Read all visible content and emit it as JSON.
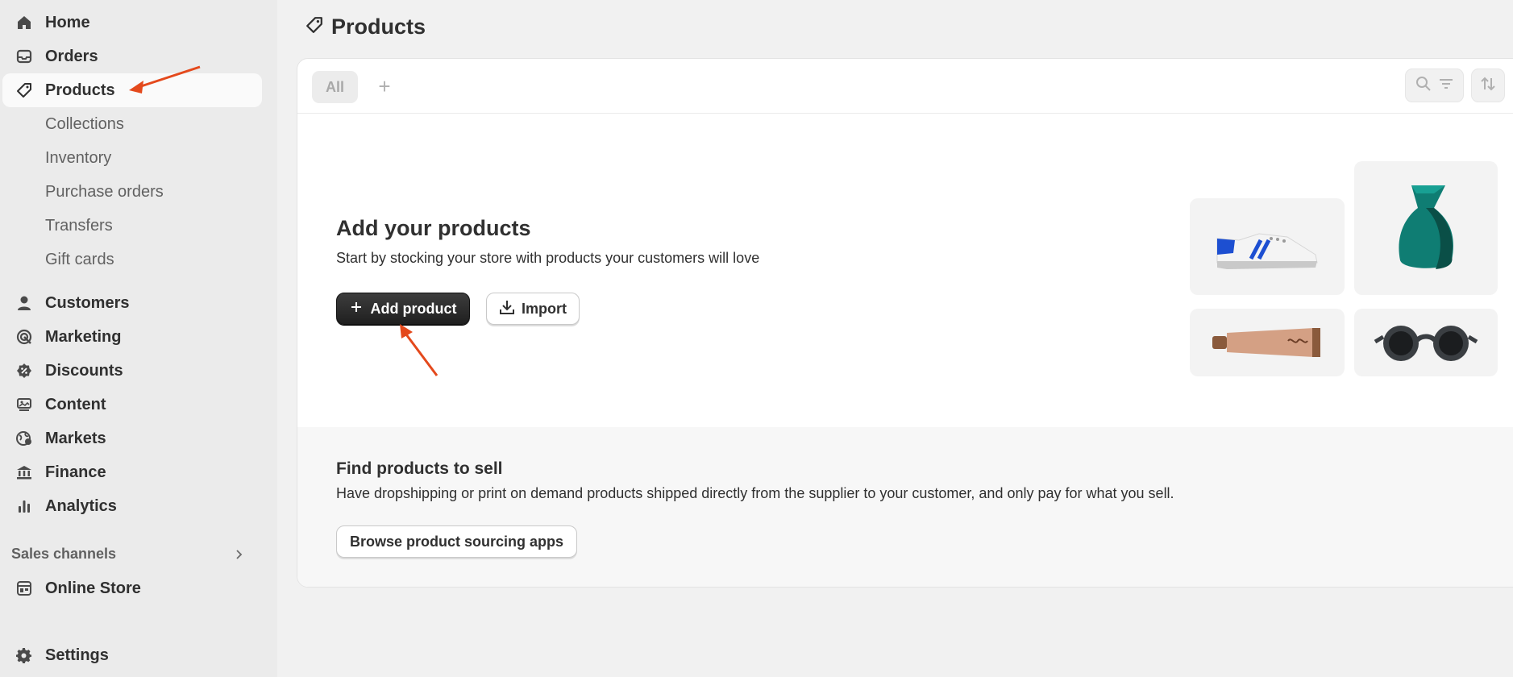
{
  "sidebar": {
    "items": [
      {
        "label": "Home",
        "icon": "home-icon"
      },
      {
        "label": "Orders",
        "icon": "inbox-icon"
      },
      {
        "label": "Products",
        "icon": "tag-icon",
        "active": true
      },
      {
        "label": "Customers",
        "icon": "person-icon"
      },
      {
        "label": "Marketing",
        "icon": "target-icon"
      },
      {
        "label": "Discounts",
        "icon": "discount-icon"
      },
      {
        "label": "Content",
        "icon": "content-icon"
      },
      {
        "label": "Markets",
        "icon": "globe-icon"
      },
      {
        "label": "Finance",
        "icon": "bank-icon"
      },
      {
        "label": "Analytics",
        "icon": "bar-chart-icon"
      }
    ],
    "product_subitems": [
      "Collections",
      "Inventory",
      "Purchase orders",
      "Transfers",
      "Gift cards"
    ],
    "sales_channels_label": "Sales channels",
    "online_store_label": "Online Store",
    "settings_label": "Settings"
  },
  "page": {
    "title": "Products"
  },
  "tabs": {
    "all_label": "All",
    "add_label": "+"
  },
  "empty_state": {
    "title": "Add your products",
    "description": "Start by stocking your store with products your customers will love",
    "add_button": "Add product",
    "import_button": "Import"
  },
  "find_products": {
    "title": "Find products to sell",
    "description": "Have dropshipping or print on demand products shipped directly from the supplier to your customer, and only pay for what you sell.",
    "browse_button": "Browse product sourcing apps"
  },
  "illustrations": [
    "sneaker",
    "vase",
    "tube",
    "sunglasses"
  ],
  "colors": {
    "annotation_arrow": "#e4491c",
    "primary_button": "#303030",
    "vase": "#0f7d73"
  }
}
